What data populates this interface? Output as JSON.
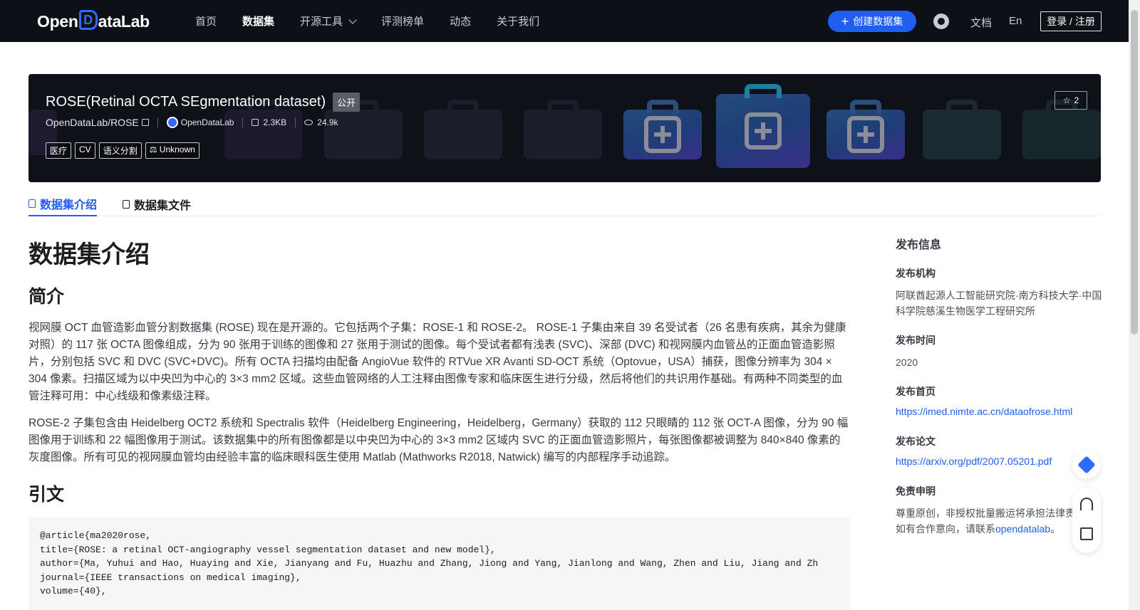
{
  "nav": {
    "logo_pre": "Open",
    "logo_mark": "D",
    "logo_post": "ataLab",
    "items": [
      {
        "label": "首页"
      },
      {
        "label": "数据集"
      },
      {
        "label": "开源工具"
      },
      {
        "label": "评测榜单"
      },
      {
        "label": "动态"
      },
      {
        "label": "关于我们"
      }
    ],
    "create_label": "创建数据集",
    "docs_label": "文档",
    "lang_label": "En",
    "login_label": "登录 / 注册"
  },
  "dataset": {
    "title": "ROSE(Retinal OCTA SEgmentation dataset)",
    "visibility": "公开",
    "star_count": "2",
    "path": "OpenDataLab/ROSE",
    "org": "OpenDataLab",
    "size": "2.3KB",
    "views": "24.9k",
    "tags": [
      "医疗",
      "CV",
      "语义分割"
    ],
    "license": "Unknown"
  },
  "tabs": {
    "intro": "数据集介绍",
    "files": "数据集文件"
  },
  "content": {
    "h1": "数据集介绍",
    "summary_heading": "简介",
    "para1": "视网膜 OCT 血管造影血管分割数据集 (ROSE) 现在是开源的。它包括两个子集：ROSE-1 和 ROSE-2。 ROSE-1 子集由来自 39 名受试者（26 名患有疾病，其余为健康对照）的 117 张 OCTA 图像组成，分为 90 张用于训练的图像和 27 张用于测试的图像。每个受试者都有浅表 (SVC)、深部 (DVC) 和视网膜内血管丛的正面血管造影照片，分别包括 SVC 和 DVC (SVC+DVC)。所有 OCTA 扫描均由配备 AngioVue 软件的 RTVue XR Avanti SD-OCT 系统（Optovue，USA）捕获，图像分辨率为 304 × 304 像素。扫描区域为以中央凹为中心的 3×3 mm2 区域。这些血管网络的人工注释由图像专家和临床医生进行分级，然后将他们的共识用作基础。有两种不同类型的血管注释可用：中心线级和像素级注释。",
    "para2": "ROSE-2 子集包含由 Heidelberg OCT2 系统和 Spectralis 软件（Heidelberg Engineering，Heidelberg，Germany）获取的 112 只眼睛的 112 张 OCT-A 图像，分为 90 幅图像用于训练和 22 幅图像用于测试。该数据集中的所有图像都是以中央凹为中心的 3×3 mm2 区域内 SVC 的正面血管造影照片，每张图像都被调整为 840×840 像素的灰度图像。所有可见的视网膜血管均由经验丰富的临床眼科医生使用 Matlab (Mathworks R2018, Natwick) 编写的内部程序手动追踪。",
    "citation_heading": "引文",
    "citation_code": "@article{ma2020rose,\ntitle={ROSE: a retinal OCT-angiography vessel segmentation dataset and new model},\nauthor={Ma, Yuhui and Hao, Huaying and Xie, Jianyang and Fu, Huazhu and Zhang, Jiong and Yang, Jianlong and Wang, Zhen and Liu, Jiang and Zh\njournal={IEEE transactions on medical imaging},\nvolume={40},"
  },
  "sidebar": {
    "title": "发布信息",
    "org_label": "发布机构",
    "org_value": "阿联酋起源人工智能研究院·南方科技大学·中国科学院慈溪生物医学工程研究所",
    "date_label": "发布时间",
    "date_value": "2020",
    "home_label": "发布首页",
    "home_url": "https://imed.nimte.ac.cn/dataofrose.html",
    "paper_label": "发布论文",
    "paper_url": "https://arxiv.org/pdf/2007.05201.pdf",
    "disclaimer_label": "免责申明",
    "disclaimer_text": "尊重原创，非授权批量搬运将承担法律责",
    "disclaimer_text2": "如有合作意向，请联系",
    "disclaimer_link": "opendatalab",
    "disclaimer_end": "。"
  },
  "icons": {
    "floating_top": "feishu-icon",
    "support": "headset-icon",
    "feedback": "edit-icon"
  },
  "colors": {
    "accent": "#1f5ef0",
    "nav_bg": "#0d1117"
  }
}
